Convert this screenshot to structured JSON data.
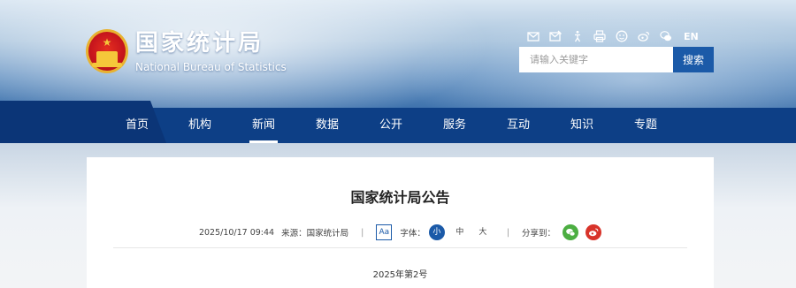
{
  "header": {
    "site_name_cn": "国家统计局",
    "site_name_en": "National Bureau of Statistics",
    "lang_switch": "EN",
    "utility_icons": [
      "mail-icon",
      "mail-edit-icon",
      "accessibility-icon",
      "print-icon",
      "elderly-icon",
      "weibo-icon",
      "wechat-icon"
    ],
    "search": {
      "placeholder": "请输入关键字",
      "button_label": "搜索"
    }
  },
  "nav": {
    "items": [
      {
        "label": "首页",
        "active": false
      },
      {
        "label": "机构",
        "active": false
      },
      {
        "label": "新闻",
        "active": true
      },
      {
        "label": "数据",
        "active": false
      },
      {
        "label": "公开",
        "active": false
      },
      {
        "label": "服务",
        "active": false
      },
      {
        "label": "互动",
        "active": false
      },
      {
        "label": "知识",
        "active": false
      },
      {
        "label": "专题",
        "active": false
      }
    ]
  },
  "article": {
    "title": "国家统计局公告",
    "date": "2025/10/17 09:44",
    "source": "来源：国家统计局",
    "font_button": "Aa",
    "font_label": "字体：",
    "font_sizes": [
      "小",
      "中",
      "大"
    ],
    "share_label": "分享到：",
    "doc_number": "2025年第2号"
  },
  "colors": {
    "nav_bg": "#0d3f86",
    "brand_blue": "#1b5aa8",
    "wechat_green": "#4cae42",
    "weibo_red": "#d8332a"
  }
}
